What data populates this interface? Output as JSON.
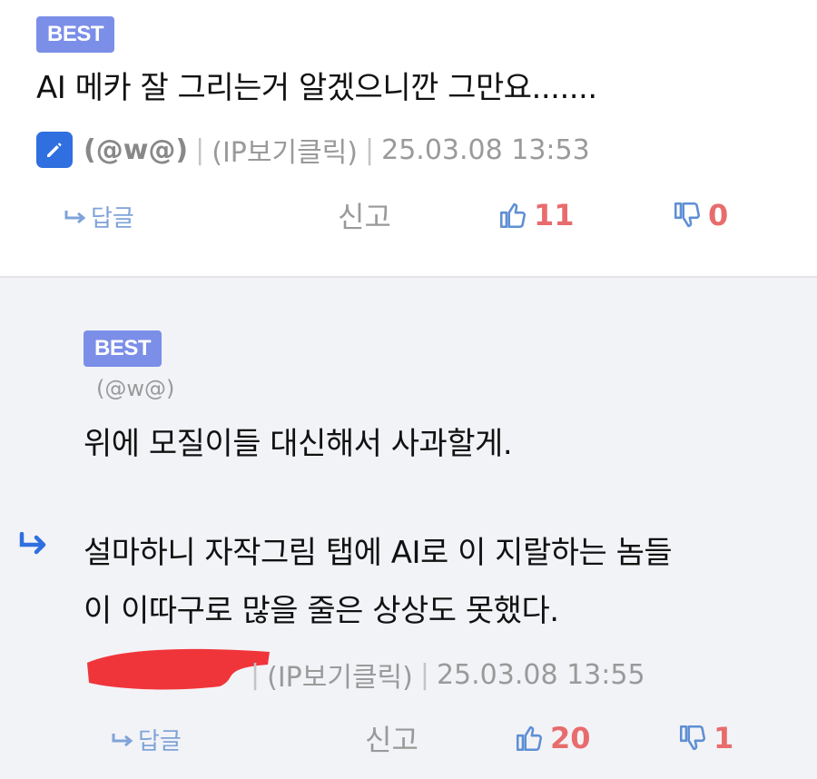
{
  "comment1": {
    "badge": "BEST",
    "text": "AI 메카 잘 그리는거 알겠으니깐 그만요.......",
    "nickname": "(@w@)",
    "ip": "(IP보기클릭)",
    "timestamp": "25.03.08 13:53",
    "reply_label": "답글",
    "report_label": "신고",
    "upvotes": "11",
    "downvotes": "0"
  },
  "comment2": {
    "badge": "BEST",
    "reply_to": "(@w@)",
    "line1": "위에 모질이들 대신해서 사과할게.",
    "line2": "설마하니 자작그림 탭에 AI로 이 지랄하는 놈들",
    "line3": "이 이따구로 많을 줄은 상상도 못했다.",
    "ip": "(IP보기클릭)",
    "timestamp": "25.03.08 13:55",
    "reply_label": "답글",
    "report_label": "신고",
    "upvotes": "20",
    "downvotes": "1"
  },
  "colors": {
    "badge": "#7b8ee8",
    "accent_blue": "#2f6fdf",
    "vote_count": "#e86c6c",
    "reply_bg": "#f2f3f7"
  },
  "icons": [
    "pencil-icon",
    "reply-arrow-icon",
    "thumbs-up-icon",
    "thumbs-down-icon",
    "reply-indicator-icon"
  ]
}
